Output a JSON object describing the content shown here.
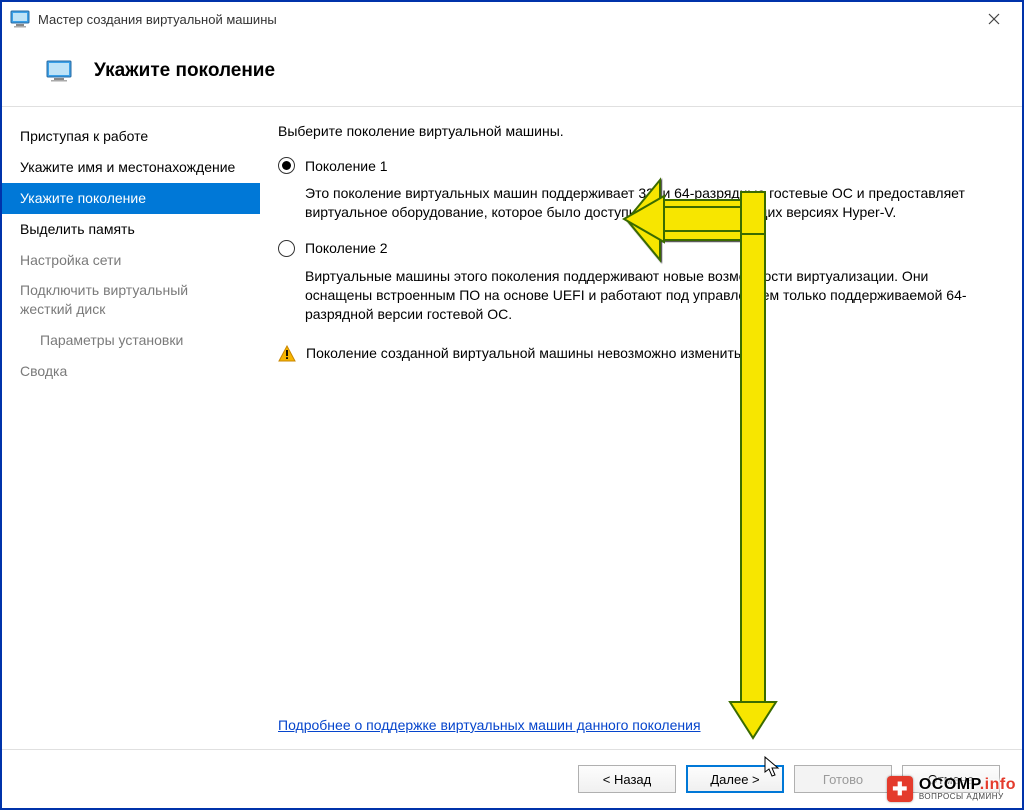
{
  "window": {
    "title": "Мастер создания виртуальной машины"
  },
  "header": {
    "title": "Укажите поколение"
  },
  "sidebar": {
    "items": [
      {
        "label": "Приступая к работе",
        "state": "done"
      },
      {
        "label": "Укажите имя и местонахождение",
        "state": "done"
      },
      {
        "label": "Укажите поколение",
        "state": "selected"
      },
      {
        "label": "Выделить память",
        "state": "next"
      },
      {
        "label": "Настройка сети",
        "state": "disabled"
      },
      {
        "label": "Подключить виртуальный жесткий диск",
        "state": "disabled"
      },
      {
        "label": "Параметры установки",
        "state": "disabled",
        "indent": true
      },
      {
        "label": "Сводка",
        "state": "disabled"
      }
    ]
  },
  "content": {
    "instruction": "Выберите поколение виртуальной машины.",
    "options": [
      {
        "label": "Поколение 1",
        "selected": true,
        "desc": "Это поколение виртуальных машин поддерживает 32- и 64-разрядные гостевые ОС и предоставляет виртуальное оборудование, которое было доступно во всех предыдущих версиях Hyper-V."
      },
      {
        "label": "Поколение 2",
        "selected": false,
        "desc": "Виртуальные машины этого поколения поддерживают новые возможности виртуализации. Они оснащены встроенным ПО на основе UEFI и работают под управлением только поддерживаемой 64-разрядной версии гостевой ОС."
      }
    ],
    "warning": "Поколение созданной виртуальной машины невозможно изменить.",
    "more_link": "Подробнее о поддержке виртуальных машин данного поколения"
  },
  "buttons": {
    "back": "< Назад",
    "next": "Далее >",
    "finish": "Готово",
    "cancel": "Отмена"
  },
  "watermark": {
    "main": "OCOMP",
    "accent": ".info",
    "sub": "ВОПРОСЫ АДМИНУ"
  }
}
